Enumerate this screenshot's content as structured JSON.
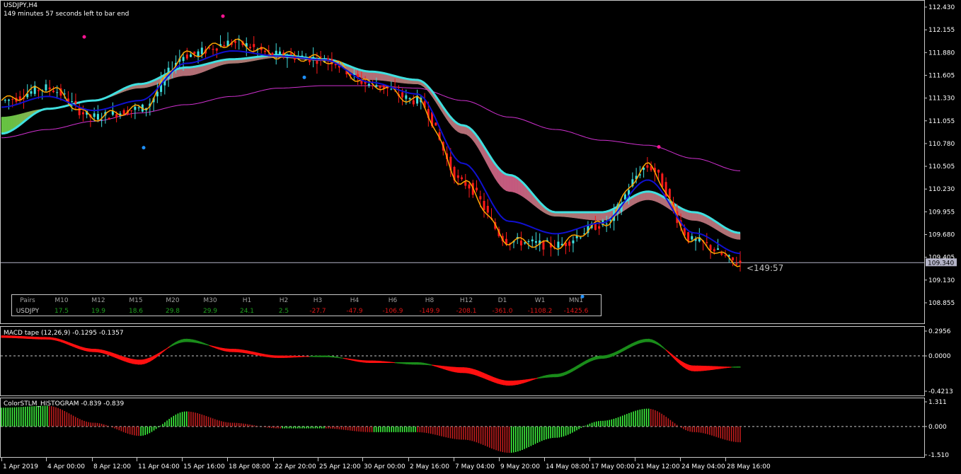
{
  "main": {
    "symbol": "USDJPY,H4",
    "timer_text": "149 minutes 57 seconds left to bar end",
    "price_ticks": [
      "112.430",
      "112.155",
      "111.880",
      "111.605",
      "111.330",
      "111.055",
      "110.780",
      "110.505",
      "110.230",
      "109.955",
      "109.680",
      "109.405",
      "109.130",
      "108.855"
    ],
    "bid_label": "109.340",
    "countdown": "<149:57"
  },
  "strength_table": {
    "headers": [
      "Pairs",
      "M10",
      "M12",
      "M15",
      "M20",
      "M30",
      "H1",
      "H2",
      "H3",
      "H4",
      "H6",
      "H8",
      "H12",
      "D1",
      "W1",
      "MN1"
    ],
    "pair": "USDJPY",
    "values": [
      "17.5",
      "19.9",
      "18.6",
      "29.8",
      "29.9",
      "24.1",
      "2.5",
      "-27.7",
      "-47.9",
      "-106.9",
      "-149.9",
      "-208.1",
      "-361.0",
      "-1108.2",
      "-1425.6"
    ],
    "positive_color": "#1ea01e",
    "negative_color": "#e01414"
  },
  "macd": {
    "label": "MACD tape (12,26,9) -0.1295 -0.1357",
    "ticks": [
      "0.2956",
      "0.0000",
      "-0.4213"
    ]
  },
  "stlm": {
    "label": "ColorSTLM_HISTOGRAM -0.839 -0.839",
    "ticks": [
      "1.311",
      "0.000",
      "-1.510"
    ]
  },
  "time_axis": [
    "1 Apr 2019",
    "4 Apr 00:00",
    "8 Apr 12:00",
    "11 Apr 04:00",
    "15 Apr 16:00",
    "18 Apr 08:00",
    "22 Apr 20:00",
    "25 Apr 12:00",
    "30 Apr 00:00",
    "2 May 16:00",
    "7 May 04:00",
    "9 May 20:00",
    "14 May 08:00",
    "17 May 00:00",
    "21 May 12:00",
    "24 May 04:00",
    "28 May 16:00"
  ],
  "colors": {
    "bull_candle": "#40e0e0",
    "bear_candle": "#ff1a1a",
    "fast_line": "#1010d0",
    "orange_line": "#ffa500",
    "cloud_edge": "#40e0e0",
    "slow_ma": "#d030d0",
    "macd_up": "#1a8c1a",
    "macd_down": "#ff1010",
    "hist_up": "#40ff40",
    "hist_down": "#c81e1e"
  },
  "chart_data": {
    "type": "candlestick",
    "title": "USDJPY,H4",
    "ylim": [
      108.855,
      112.43
    ],
    "x": [
      "1 Apr 2019",
      "4 Apr 00:00",
      "8 Apr 12:00",
      "11 Apr 04:00",
      "15 Apr 16:00",
      "18 Apr 08:00",
      "22 Apr 20:00",
      "25 Apr 12:00",
      "30 Apr 00:00",
      "2 May 16:00",
      "7 May 04:00",
      "9 May 20:00",
      "14 May 08:00",
      "17 May 00:00",
      "21 May 12:00",
      "24 May 04:00",
      "28 May 16:00"
    ],
    "series": [
      {
        "name": "close",
        "values": [
          111.3,
          111.45,
          111.1,
          111.2,
          111.85,
          112.0,
          111.85,
          111.8,
          111.5,
          111.3,
          110.3,
          109.6,
          109.55,
          109.8,
          110.5,
          109.6,
          109.34
        ]
      },
      {
        "values": [
          111.1,
          111.2,
          111.3,
          111.45,
          111.6,
          111.75,
          111.82,
          111.78,
          111.55,
          111.5,
          110.9,
          110.2,
          109.9,
          109.85,
          110.1,
          109.85,
          109.62
        ]
      },
      {
        "values": [
          110.85,
          110.95,
          111.05,
          111.15,
          111.25,
          111.35,
          111.45,
          111.48,
          111.48,
          111.45,
          111.3,
          111.1,
          110.95,
          110.82,
          110.76,
          110.6,
          110.45
        ]
      }
    ],
    "markers_high": [
      111.95,
      112.2,
      112.42,
      110.62
    ],
    "markers_low": [
      110.85,
      111.7,
      109.05
    ]
  }
}
